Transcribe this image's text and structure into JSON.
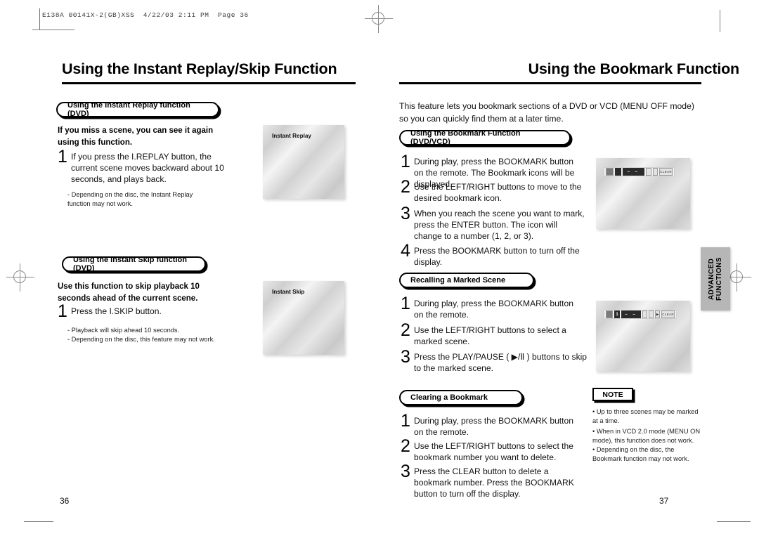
{
  "print_header": {
    "filename_line": "E138A 00141X-2(GB)XSS  4/22/03 2:11 PM  Page 36"
  },
  "left_page": {
    "title": "Using the Instant Replay/Skip Function",
    "page_number": "36",
    "sections": [
      {
        "heading": "Using the Instant Replay function (DVD)",
        "lead": "If you miss a scene, you can see it again using this function.",
        "steps": [
          {
            "num": "1",
            "text": "If you press the I.REPLAY button, the current scene moves backward about 10 seconds, and plays back."
          }
        ],
        "notes": "- Depending on the disc, the Instant Replay\n  function may not work.",
        "screen_caption": "Instant Replay"
      },
      {
        "heading": "Using the Instant Skip function (DVD)",
        "lead": "Use this function to skip playback 10 seconds ahead of the current scene.",
        "steps": [
          {
            "num": "1",
            "text": "Press the I.SKIP button."
          }
        ],
        "notes": "- Playback will skip ahead 10 seconds.\n- Depending on the disc, this feature may not work.",
        "screen_caption": "Instant Skip"
      }
    ]
  },
  "right_page": {
    "title": "Using the Bookmark Function",
    "page_number": "37",
    "intro": "This feature lets you bookmark sections of a DVD or VCD (MENU OFF mode) so you can quickly find them at a later time.",
    "sections": [
      {
        "heading": "Using the Bookmark Function (DVD/VCD)",
        "steps": [
          {
            "num": "1",
            "text": "During play, press the BOOKMARK button on the remote. The Bookmark icons will be displayed."
          },
          {
            "num": "2",
            "text": "Use the LEFT/RIGHT buttons to move to the desired bookmark icon."
          },
          {
            "num": "3",
            "text": "When you reach the scene you want to mark, press the ENTER button. The icon will change to a number (1, 2, or 3)."
          },
          {
            "num": "4",
            "text": "Press the BOOKMARK button to turn off the display."
          }
        ]
      },
      {
        "heading": "Recalling a Marked Scene",
        "steps": [
          {
            "num": "1",
            "text": "During play, press the BOOKMARK button on the remote."
          },
          {
            "num": "2",
            "text": "Use the LEFT/RIGHT buttons to select a marked scene."
          },
          {
            "num": "3",
            "text": "Press the PLAY/PAUSE ( ▶/Ⅱ ) buttons to skip to the marked scene."
          }
        ]
      },
      {
        "heading": "Clearing a Bookmark",
        "steps": [
          {
            "num": "1",
            "text": "During play, press the BOOKMARK button on the remote."
          },
          {
            "num": "2",
            "text": "Use the LEFT/RIGHT buttons to select the bookmark number you want to delete."
          },
          {
            "num": "3",
            "text": "Press the CLEAR button to delete a bookmark number. Press the BOOKMARK button to turn off the display."
          }
        ]
      }
    ],
    "osd_screens": [
      {
        "bookmark_number": "",
        "dashes": "–  –",
        "clear_label": "CLEAR"
      },
      {
        "bookmark_number": "1",
        "dashes": "–  –",
        "clear_label": "CLEAR"
      }
    ],
    "note_box": {
      "label": "NOTE",
      "items": [
        "• Up to three scenes may be marked\n   at a time.",
        "• When in VCD 2.0 mode (MENU ON\n   mode), this function does not work.",
        "• Depending on the disc, the\n   Bookmark function may not work."
      ]
    },
    "side_tab": "ADVANCED\nFUNCTIONS"
  }
}
